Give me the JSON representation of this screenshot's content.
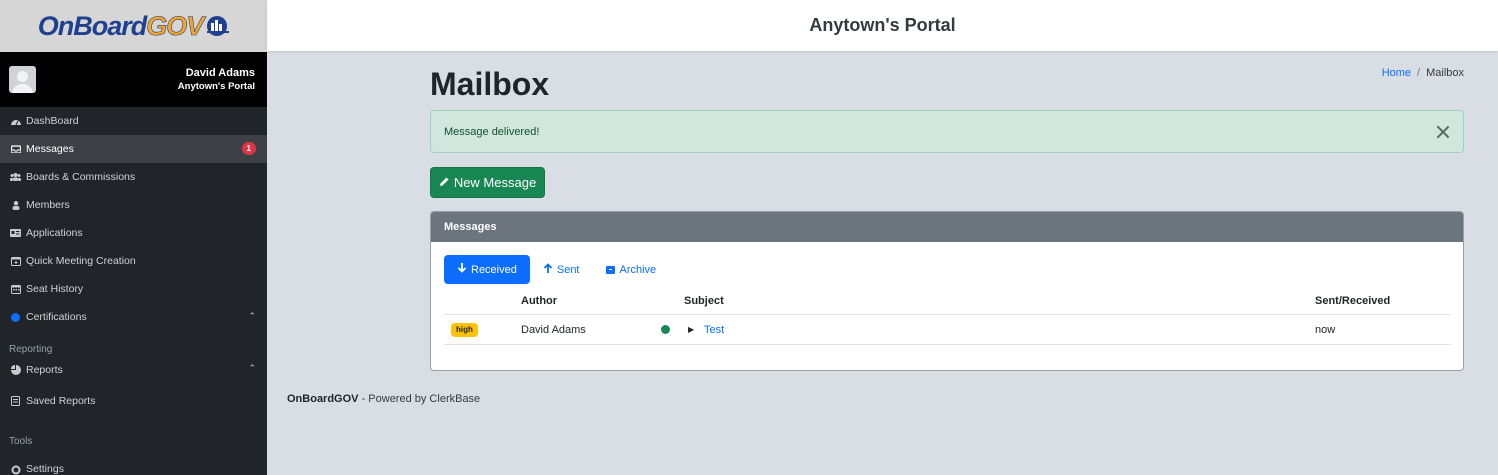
{
  "app": {
    "logo_on": "OnBoard",
    "logo_gov": "GOV",
    "portal_title": "Anytown's Portal"
  },
  "user": {
    "name": "David Adams",
    "portal": "Anytown's Portal"
  },
  "sidebar": {
    "items": [
      {
        "label": "DashBoard",
        "icon": "dashboard-icon"
      },
      {
        "label": "Messages",
        "icon": "inbox-icon",
        "badge": "1",
        "active": true
      },
      {
        "label": "Boards & Commissions",
        "icon": "users-icon"
      },
      {
        "label": "Members",
        "icon": "user-icon"
      },
      {
        "label": "Applications",
        "icon": "id-card-icon"
      },
      {
        "label": "Quick Meeting Creation",
        "icon": "calendar-plus-icon"
      },
      {
        "label": "Seat History",
        "icon": "calendar-icon"
      },
      {
        "label": "Certifications",
        "icon": "blue-dot-icon"
      }
    ],
    "reporting_heading": "Reporting",
    "reporting_items": [
      {
        "label": "Reports",
        "icon": "chart-pie-icon"
      },
      {
        "label": "Saved Reports",
        "icon": "file-icon"
      }
    ],
    "tools_heading": "Tools",
    "tools_items": [
      {
        "label": "Settings",
        "icon": "gear-icon"
      }
    ]
  },
  "page": {
    "title": "Mailbox",
    "breadcrumb_home": "Home",
    "breadcrumb_current": "Mailbox",
    "alert_text": "Message delivered!",
    "new_message_label": "New Message"
  },
  "messages": {
    "card_title": "Messages",
    "tabs": {
      "received": "Received",
      "sent": "Sent",
      "archive": "Archive"
    },
    "columns": {
      "author": "Author",
      "subject": "Subject",
      "sent_received": "Sent/Received"
    },
    "rows": [
      {
        "priority": "high",
        "author": "David Adams",
        "subject": "Test",
        "time": "now"
      }
    ]
  },
  "footer": {
    "brand": "OnBoardGOV",
    "tagline": " - Powered by ClerkBase"
  },
  "colors": {
    "primary": "#0d6efd",
    "success": "#198754",
    "sidebar_bg": "#212529",
    "badge_danger": "#dc3545",
    "priority_high": "#ffc107"
  }
}
